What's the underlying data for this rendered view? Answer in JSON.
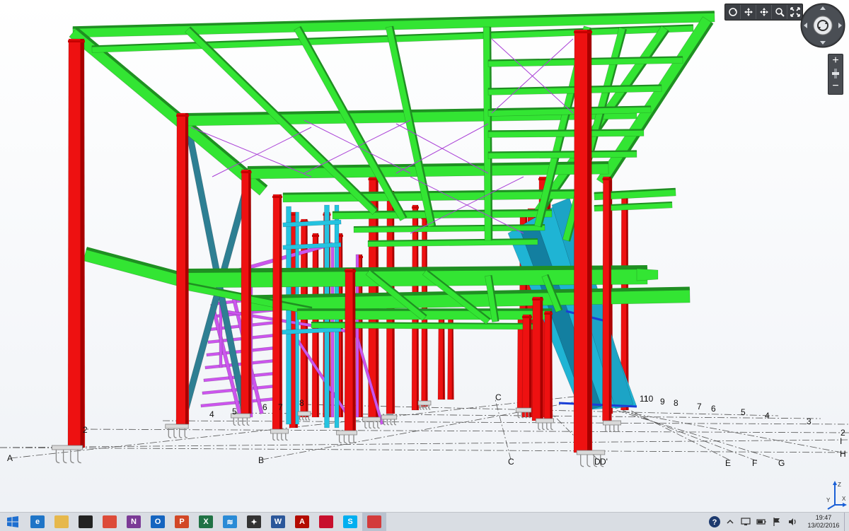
{
  "viewer": {
    "grid_labels": {
      "letters": [
        "A",
        "B",
        "C",
        "C",
        "D",
        "D'",
        "E",
        "F",
        "G",
        "H",
        "I"
      ],
      "numbers": [
        "2",
        "4",
        "5",
        "6",
        "7",
        "8",
        "3",
        "2",
        "4",
        "5",
        "6",
        "7",
        "8",
        "9",
        "10",
        "11"
      ]
    },
    "colors": {
      "beam": "#33e533",
      "beam_dark": "#1f8f22",
      "column": "#ee1111",
      "column_dark": "#a80000",
      "brace_steel": "#2e7f93",
      "stair": "#cc55ee",
      "cyan": "#25c3e0",
      "bracing_wire": "#a93fd6"
    },
    "toolbar_icons": [
      "orbit-icon",
      "pan-icon",
      "look-icon",
      "zoom-window-icon",
      "fit-view-icon"
    ],
    "nav_wheel_icon": "orbit-icon",
    "zoom_in": "+",
    "zoom_out": "−",
    "axis_labels": {
      "z": "Z",
      "y": "Y",
      "x": "X"
    }
  },
  "taskbar": {
    "apps": [
      {
        "name": "internet-explorer",
        "glyph": "e",
        "color": "#1f75c7"
      },
      {
        "name": "file-explorer",
        "glyph": "",
        "color": "#e6b84c"
      },
      {
        "name": "photos",
        "glyph": "",
        "color": "#222222"
      },
      {
        "name": "chrome",
        "glyph": "",
        "color": "#dd4b39"
      },
      {
        "name": "onenote",
        "glyph": "N",
        "color": "#7b3a96"
      },
      {
        "name": "outlook",
        "glyph": "O",
        "color": "#1565c0"
      },
      {
        "name": "powerpoint",
        "glyph": "P",
        "color": "#d24726"
      },
      {
        "name": "excel",
        "glyph": "X",
        "color": "#207245"
      },
      {
        "name": "layers",
        "glyph": "≋",
        "color": "#2a8bd6"
      },
      {
        "name": "app-star",
        "glyph": "✦",
        "color": "#333333"
      },
      {
        "name": "word",
        "glyph": "W",
        "color": "#2b579a"
      },
      {
        "name": "acrobat",
        "glyph": "A",
        "color": "#b30b00"
      },
      {
        "name": "autodesk",
        "glyph": "",
        "color": "#c8102e"
      },
      {
        "name": "skype",
        "glyph": "S",
        "color": "#00aff0"
      },
      {
        "name": "robot-structural",
        "glyph": "",
        "color": "#d33b3b"
      }
    ],
    "clock": {
      "time": "19:47",
      "date": "13/02/2016"
    }
  }
}
